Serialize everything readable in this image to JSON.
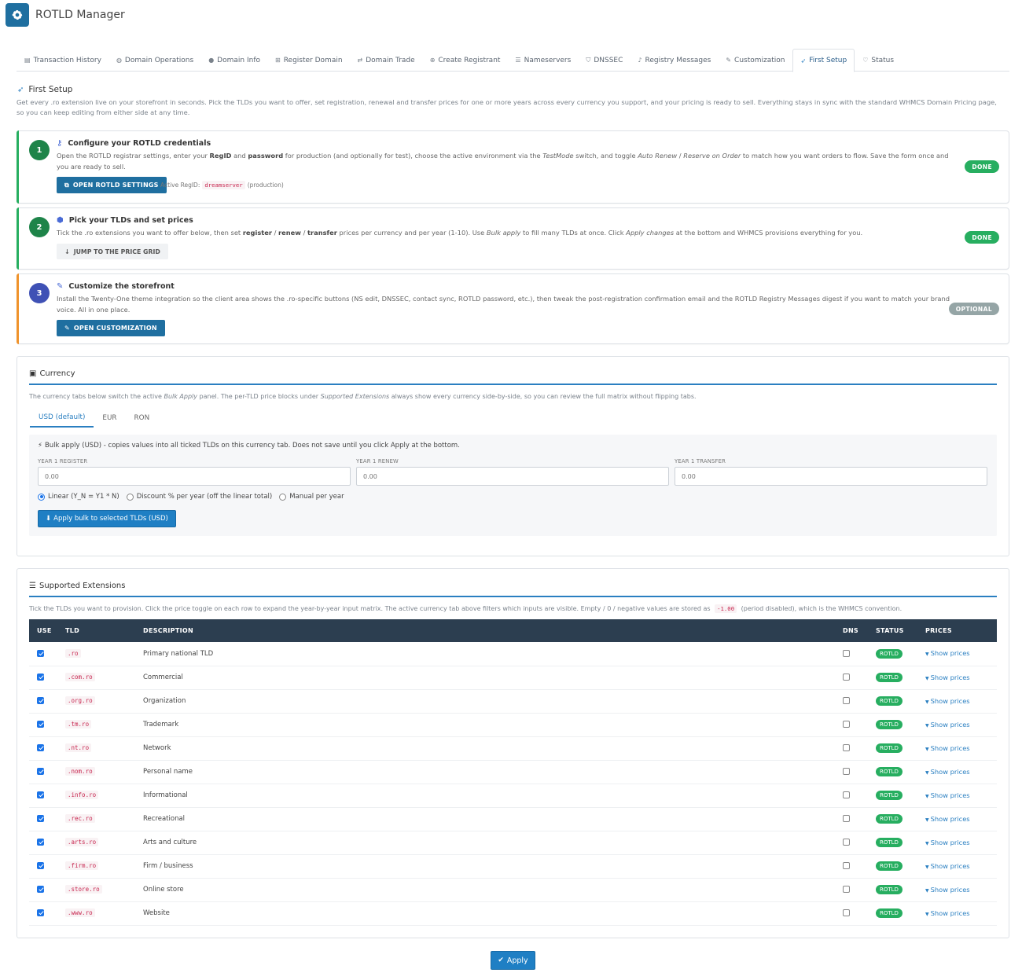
{
  "app": {
    "title": "ROTLD Manager",
    "logo_icon": "gear-icon",
    "brand_color": "#1f6fa0"
  },
  "tabs": [
    {
      "label": "Transaction History",
      "icon": "table-icon",
      "active": false
    },
    {
      "label": "Domain Operations",
      "icon": "globe-icon",
      "active": false
    },
    {
      "label": "Domain Info",
      "icon": "info-icon",
      "active": false
    },
    {
      "label": "Register Domain",
      "icon": "plus-square-icon",
      "active": false
    },
    {
      "label": "Domain Trade",
      "icon": "exchange-icon",
      "active": false
    },
    {
      "label": "Create Registrant",
      "icon": "plus-circle-icon",
      "active": false
    },
    {
      "label": "Nameservers",
      "icon": "list-icon",
      "active": false
    },
    {
      "label": "DNSSEC",
      "icon": "shield-icon",
      "active": false
    },
    {
      "label": "Registry Messages",
      "icon": "bell-icon",
      "active": false
    },
    {
      "label": "Customization",
      "icon": "brush-icon",
      "active": false
    },
    {
      "label": "First Setup",
      "icon": "rocket-icon",
      "active": true
    },
    {
      "label": "Status",
      "icon": "heartbeat-icon",
      "active": false
    }
  ],
  "first_setup": {
    "title": "First Setup",
    "description": "Get every .ro extension live on your storefront in seconds. Pick the TLDs you want to offer, set registration, renewal and transfer prices for one or more years across every currency you support, and your pricing is ready to sell. Everything stays in sync with the standard WHMCS Domain Pricing page, so you can keep editing from either side at any time."
  },
  "steps": [
    {
      "number": "1",
      "title": "Configure your ROTLD credentials",
      "text_parts": [
        "Open the ROTLD registrar settings, enter your ",
        "RegID",
        " and ",
        "password",
        " for production (and optionally for test), choose the active environment via the ",
        "TestMode",
        " switch, and toggle ",
        "Auto Renew",
        " / ",
        "Reserve on Order",
        " to match how you want orders to flow. Save the form once and you are ready to sell."
      ],
      "button": "OPEN ROTLD SETTINGS",
      "regid_label": "Active RegID:",
      "regid_value": "dreamserver",
      "regid_env": "(production)",
      "badge": "DONE",
      "color": "#27ae60"
    },
    {
      "number": "2",
      "title": "Pick your TLDs and set prices",
      "text_parts": [
        "Tick the .ro extensions you want to offer below, then set ",
        "register",
        " / ",
        "renew",
        " / ",
        "transfer",
        " prices per currency and per year (1-10). Use ",
        "Bulk apply",
        " to fill many TLDs at once. Click ",
        "Apply changes",
        " at the bottom and WHMCS provisions everything for you."
      ],
      "button": "JUMP TO THE PRICE GRID",
      "badge": "DONE",
      "color": "#27ae60"
    },
    {
      "number": "3",
      "title": "Customize the storefront",
      "text": "Install the Twenty-One theme integration so the client area shows the .ro-specific buttons (NS edit, DNSSEC, contact sync, ROTLD password, etc.), then tweak the post-registration confirmation email and the ROTLD Registry Messages digest if you want to match your brand voice. All in one place.",
      "button": "OPEN CUSTOMIZATION",
      "badge": "OPTIONAL",
      "color": "#f0932b",
      "circle_color": "#3f51b5",
      "badge_color": "#95a5a6"
    }
  ],
  "currency": {
    "title": "Currency",
    "desc_parts": [
      "The currency tabs below switch the active ",
      "Bulk Apply",
      " panel. The per-TLD price blocks under ",
      "Supported Extensions",
      " always show every currency side-by-side, so you can review the full matrix without flipping tabs."
    ],
    "tabs": [
      "USD (default)",
      "EUR",
      "RON"
    ],
    "bulk_head": "Bulk apply (USD) - copies values into all ticked TLDs on this currency tab. Does not save until you click Apply at the bottom.",
    "fields": [
      {
        "label": "YEAR 1 REGISTER",
        "placeholder": "0.00"
      },
      {
        "label": "YEAR 1 RENEW",
        "placeholder": "0.00"
      },
      {
        "label": "YEAR 1 TRANSFER",
        "placeholder": "0.00"
      }
    ],
    "modes": [
      "Linear (Y_N = Y1 * N)",
      "Discount % per year (off the linear total)",
      "Manual per year"
    ],
    "selected_mode": 0,
    "apply_bulk_label": "Apply bulk to selected TLDs (USD)"
  },
  "extensions": {
    "title": "Supported Extensions",
    "desc_before": "Tick the TLDs you want to provision. Click the price toggle on each row to expand the year-by-year input matrix. The active currency tab above filters which inputs are visible. Empty / 0 / negative values are stored as ",
    "desc_code": "-1.00",
    "desc_after": " (period disabled), which is the WHMCS convention.",
    "columns": [
      "USE",
      "TLD",
      "DESCRIPTION",
      "DNS",
      "STATUS",
      "PRICES"
    ],
    "show_prices_label": "Show prices",
    "rows": [
      {
        "tld": ".ro",
        "description": "Primary national TLD",
        "status": "ROTLD",
        "use": true,
        "dns": false
      },
      {
        "tld": ".com.ro",
        "description": "Commercial",
        "status": "ROTLD",
        "use": true,
        "dns": false
      },
      {
        "tld": ".org.ro",
        "description": "Organization",
        "status": "ROTLD",
        "use": true,
        "dns": false
      },
      {
        "tld": ".tm.ro",
        "description": "Trademark",
        "status": "ROTLD",
        "use": true,
        "dns": false
      },
      {
        "tld": ".nt.ro",
        "description": "Network",
        "status": "ROTLD",
        "use": true,
        "dns": false
      },
      {
        "tld": ".nom.ro",
        "description": "Personal name",
        "status": "ROTLD",
        "use": true,
        "dns": false
      },
      {
        "tld": ".info.ro",
        "description": "Informational",
        "status": "ROTLD",
        "use": true,
        "dns": false
      },
      {
        "tld": ".rec.ro",
        "description": "Recreational",
        "status": "ROTLD",
        "use": true,
        "dns": false
      },
      {
        "tld": ".arts.ro",
        "description": "Arts and culture",
        "status": "ROTLD",
        "use": true,
        "dns": false
      },
      {
        "tld": ".firm.ro",
        "description": "Firm / business",
        "status": "ROTLD",
        "use": true,
        "dns": false
      },
      {
        "tld": ".store.ro",
        "description": "Online store",
        "status": "ROTLD",
        "use": true,
        "dns": false
      },
      {
        "tld": ".www.ro",
        "description": "Website",
        "status": "ROTLD",
        "use": true,
        "dns": false
      }
    ]
  },
  "footer": {
    "apply_label": "Apply"
  }
}
